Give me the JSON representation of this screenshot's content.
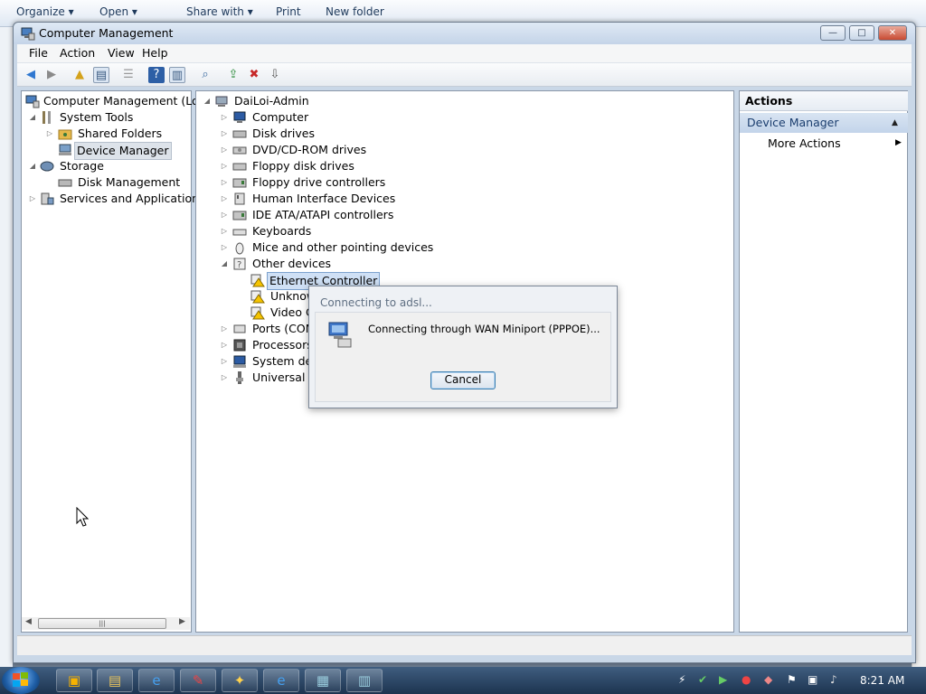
{
  "background_explorer": {
    "organize": "Organize ▾",
    "open": "Open ▾",
    "share_with": "Share with ▾",
    "print": "Print",
    "new_folder": "New folder"
  },
  "window": {
    "title": "Computer Management",
    "minimize": "—",
    "maximize": "□",
    "close": "✕"
  },
  "menu": {
    "file": "File",
    "action": "Action",
    "view": "View",
    "help": "Help"
  },
  "left_tree": {
    "root": "Computer Management (Local",
    "system_tools": "System Tools",
    "shared_folders": "Shared Folders",
    "device_manager": "Device Manager",
    "storage": "Storage",
    "disk_management": "Disk Management",
    "services": "Services and Applications"
  },
  "device_tree": {
    "root": "DaiLoi-Admin",
    "items": [
      "Computer",
      "Disk drives",
      "DVD/CD-ROM drives",
      "Floppy disk drives",
      "Floppy drive controllers",
      "Human Interface Devices",
      "IDE ATA/ATAPI controllers",
      "Keyboards",
      "Mice and other pointing devices",
      "Other devices"
    ],
    "other_children": [
      "Ethernet Controller",
      "Unknow",
      "Video Co"
    ],
    "after": [
      "Ports (COM",
      "Processors",
      "System devi",
      "Universal Se"
    ]
  },
  "actions_pane": {
    "header": "Actions",
    "section": "Device Manager",
    "more": "More Actions"
  },
  "dialog": {
    "title": "Connecting to adsl...",
    "message": "Connecting through WAN Miniport (PPPOE)...",
    "cancel": "Cancel"
  },
  "taskbar": {
    "time": "8:21 AM"
  },
  "colors": {
    "accent": "#1f5fa7",
    "selection": "#cfe0f5",
    "warning": "#f5c400"
  }
}
